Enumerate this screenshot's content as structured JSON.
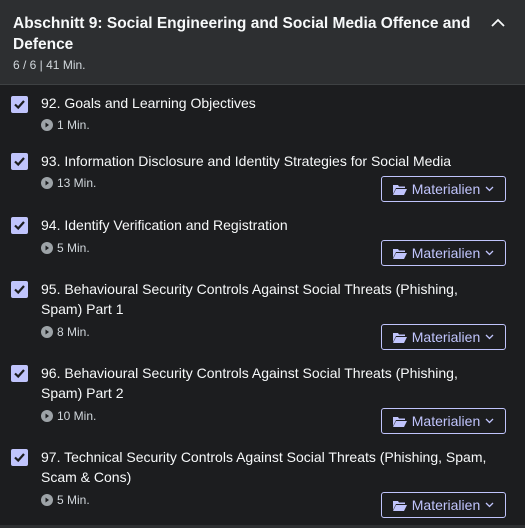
{
  "section": {
    "title": "Abschnitt 9: Social Engineering and Social Media Offence and Defence",
    "meta": "6 / 6 | 41 Min."
  },
  "materials_label": "Materialien",
  "lectures": [
    {
      "title": "92. Goals and Learning Objectives",
      "duration": "1 Min.",
      "completed": true,
      "has_materials": false
    },
    {
      "title": "93. Information Disclosure and Identity Strategies for Social Media",
      "duration": "13 Min.",
      "completed": true,
      "has_materials": true
    },
    {
      "title": "94. Identify Verification and Registration",
      "duration": "5 Min.",
      "completed": true,
      "has_materials": true
    },
    {
      "title": "95. Behavioural Security Controls Against Social Threats (Phishing, Spam) Part 1",
      "duration": "8 Min.",
      "completed": true,
      "has_materials": true
    },
    {
      "title": "96. Behavioural Security Controls Against Social Threats (Phishing, Spam) Part 2",
      "duration": "10 Min.",
      "completed": true,
      "has_materials": true
    },
    {
      "title": "97. Technical Security Controls Against Social Threats (Phishing, Spam, Scam & Cons)",
      "duration": "5 Min.",
      "completed": true,
      "has_materials": true
    }
  ]
}
